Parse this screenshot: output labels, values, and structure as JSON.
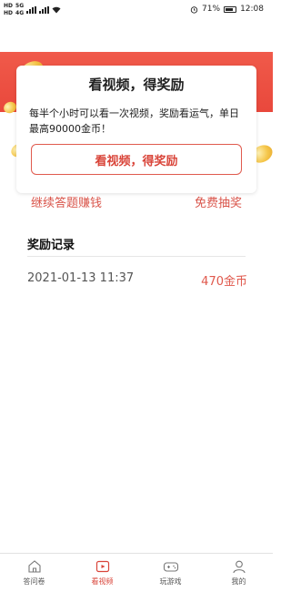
{
  "status_bar": {
    "network_left_1": "HD",
    "network_left_2": "5G",
    "network_left_3": "HD",
    "network_left_4": "4G",
    "battery": "71%",
    "time": "12:08"
  },
  "card": {
    "title": "看视频，得奖励",
    "description": "每半个小时可以看一次视频，奖励看运气，单日最高90000金币！",
    "button_label": "看视频，得奖励"
  },
  "links": {
    "left": "继续答题赚钱",
    "right": "免费抽奖"
  },
  "records": {
    "title": "奖励记录",
    "items": [
      {
        "time": "2021-01-13 11:37",
        "amount": "470金币"
      }
    ]
  },
  "bottom_nav": {
    "items": [
      {
        "label": "答问卷",
        "icon": "home-icon",
        "active": false
      },
      {
        "label": "看视频",
        "icon": "video-icon",
        "active": true
      },
      {
        "label": "玩游戏",
        "icon": "gamepad-icon",
        "active": false
      },
      {
        "label": "我的",
        "icon": "profile-icon",
        "active": false
      }
    ]
  },
  "colors": {
    "accent": "#d9453a",
    "banner": "#ef5647",
    "coin": "#f5c64a"
  }
}
